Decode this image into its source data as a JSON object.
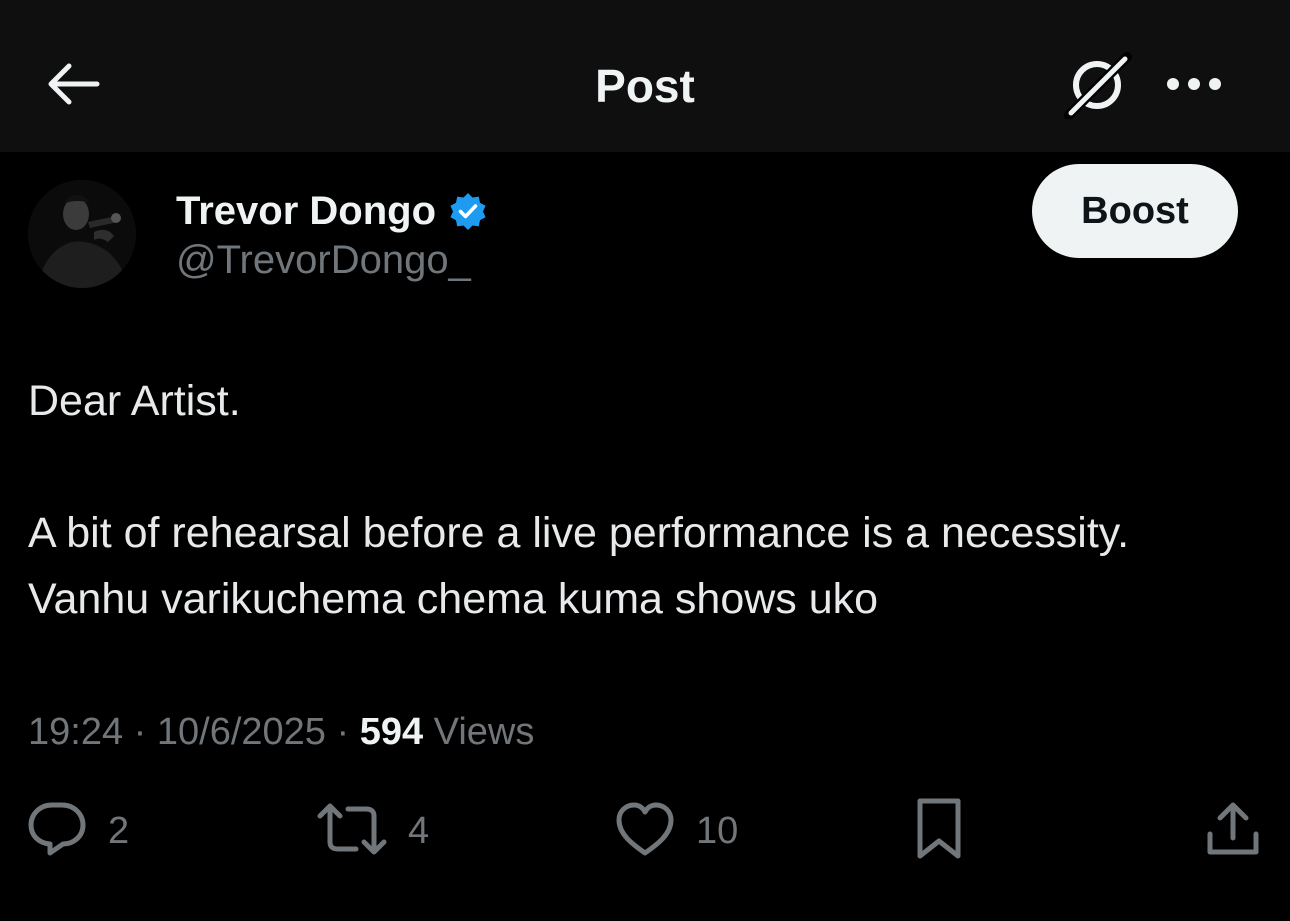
{
  "header": {
    "title": "Post",
    "back_icon": "arrow-left-icon",
    "grok_icon": "grok-icon",
    "more_icon": "more-horizontal-icon"
  },
  "author": {
    "name": "Trevor Dongo",
    "handle": "@TrevorDongo_",
    "verified": true,
    "verified_color": "#1d9bf0",
    "avatar_icon": "avatar"
  },
  "boost_label": "Boost",
  "post": {
    "lines": [
      "Dear Artist.",
      "",
      "A bit of rehearsal before a live performance is a necessity.",
      "Vanhu varikuchema chema kuma shows uko"
    ]
  },
  "meta": {
    "time": "19:24",
    "separator": " · ",
    "date": "10/6/2025",
    "views_count": "594",
    "views_label": " Views"
  },
  "actions": {
    "replies": "2",
    "reposts": "4",
    "likes": "10"
  },
  "colors": {
    "background": "#000000",
    "header_background": "#0f0f0f",
    "primary_text": "#e7e9ea",
    "secondary_text": "#71767b",
    "accent": "#1d9bf0",
    "boost_bg": "#eff3f4"
  }
}
